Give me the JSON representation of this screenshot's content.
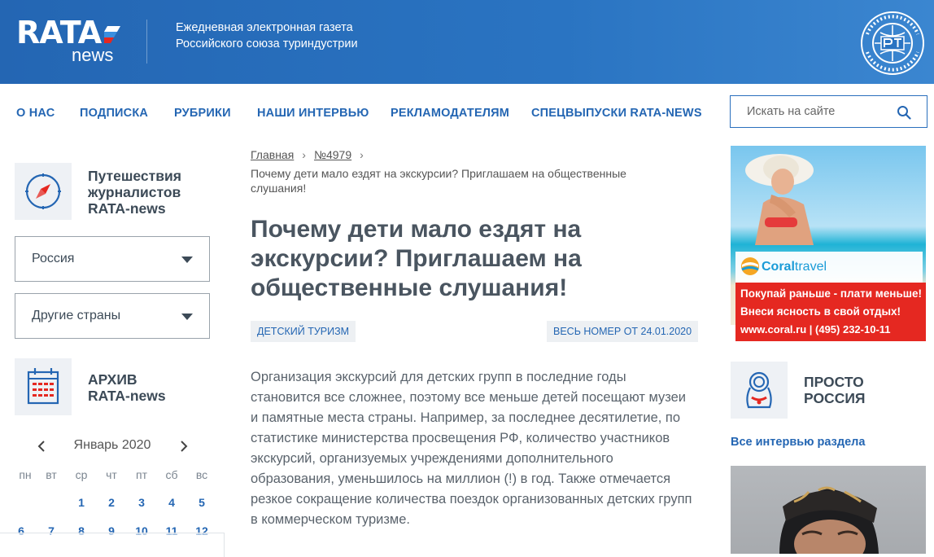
{
  "header": {
    "logo_main": "RATA",
    "logo_sub": "news",
    "tagline_line1": "Ежедневная электронная газета",
    "tagline_line2": "Российского союза туриндустрии"
  },
  "nav": {
    "items": [
      "О НАС",
      "ПОДПИСКА",
      "РУБРИКИ",
      "НАШИ ИНТЕРВЬЮ",
      "РЕКЛАМОДАТЕЛЯМ",
      "СПЕЦВЫПУСКИ RATA-NEWS"
    ],
    "search_placeholder": "Искать на сайте"
  },
  "left_sidebar": {
    "travel_title_line1": "Путешествия",
    "travel_title_line2": "журналистов",
    "travel_title_line3": "RATA-news",
    "select_russia": "Россия",
    "select_other": "Другие страны",
    "archive_title_line1": "АРХИВ",
    "archive_title_line2": "RATA-news",
    "calendar": {
      "month": "Январь 2020",
      "weekdays": [
        "пн",
        "вт",
        "ср",
        "чт",
        "пт",
        "сб",
        "вс"
      ],
      "row1": [
        "",
        "",
        "1",
        "2",
        "3",
        "4",
        "5"
      ],
      "row2": [
        "6",
        "7",
        "8",
        "9",
        "10",
        "11",
        "12"
      ]
    }
  },
  "breadcrumb": {
    "home": "Главная",
    "issue": "№4979",
    "current": "Почему дети мало ездят на экскурсии? Приглашаем на общественные слушания!"
  },
  "article": {
    "title": "Почему дети мало ездят на экскурсии? Приглашаем на общественные слушания!",
    "tag": "ДЕТСКИЙ ТУРИЗМ",
    "issue_link": "ВЕСЬ НОМЕР ОТ 24.01.2020",
    "body": "Организация экскурсий для детских групп в последние годы становится все сложнее, поэтому все меньше детей посещают музеи и памятные места страны. Например, за последнее десятилетие, по статистике министерства просвещения РФ, количество участников экскурсий, организуемых учреждениями дополнительного образования, уменьшилось на миллион (!) в год. Также отмечается резкое сокращение количества поездок организованных детских групп в коммерческом туризме."
  },
  "right_sidebar": {
    "ad": {
      "brand": "Coral",
      "brand_suffix": "travel",
      "line1": "Покупай раньше - плати меньше!",
      "line2": "Внеси ясность в свой отдых!",
      "line3": "www.coral.ru  |  (495) 232-10-11"
    },
    "section_title_line1": "ПРОСТО",
    "section_title_line2": "РОССИЯ",
    "interviews_link": "Все интервью раздела"
  },
  "colors": {
    "brand_blue": "#2466b3",
    "header_blue": "#2a74c2",
    "text_dark": "#3c4a57",
    "ad_red": "#e52821"
  }
}
